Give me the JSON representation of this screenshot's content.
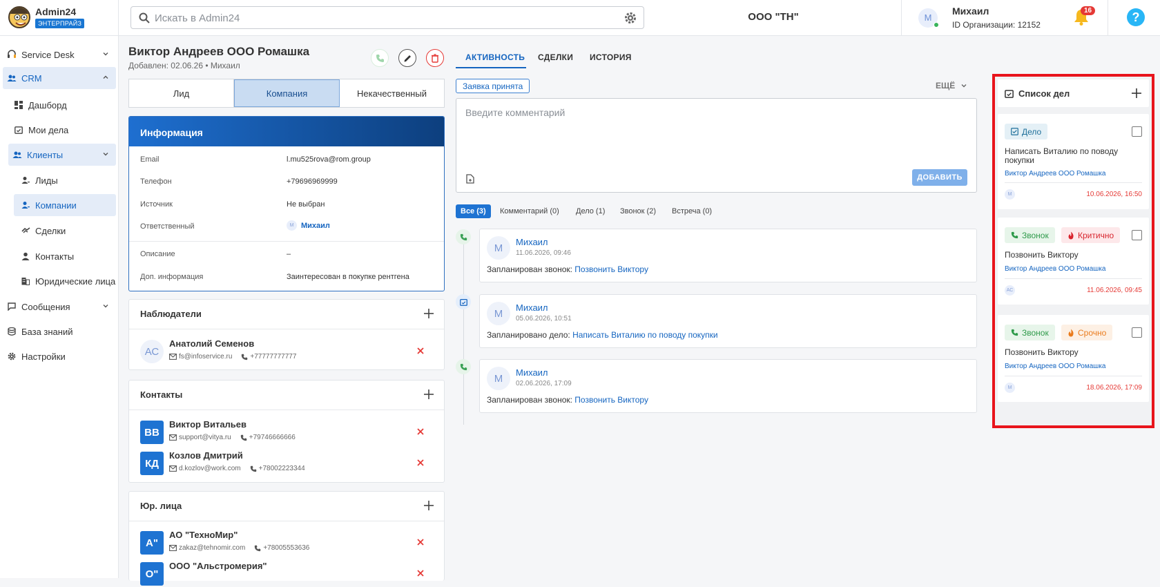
{
  "header": {
    "app_name": "Admin24",
    "edition_badge": "ЭНТЕРПРАЙЗ",
    "search_placeholder": "Искать в Admin24",
    "organization": "ООО \"ТН\"",
    "user_initial": "М",
    "user_name": "Михаил",
    "org_id": "ID Организации: 12152",
    "notifications_count": "16",
    "help_label": "?"
  },
  "sidebar": {
    "service_desk": "Service Desk",
    "crm": "CRM",
    "dashboard": "Дашборд",
    "my_tasks": "Мои дела",
    "clients": "Клиенты",
    "leads": "Лиды",
    "companies": "Компании",
    "deals": "Сделки",
    "contacts": "Контакты",
    "legal_entities": "Юридические лица",
    "messages": "Сообщения",
    "knowledge_base": "База знаний",
    "settings": "Настройки"
  },
  "entity": {
    "title": "Виктор Андреев ООО Ромашка",
    "subtitle": "Добавлен: 02.06.26 • Михаил",
    "status_tabs": [
      "Лид",
      "Компания",
      "Некачественный"
    ],
    "active_status": "Компания"
  },
  "info": {
    "header": "Информация",
    "email_label": "Email",
    "email_value": "l.mu525rova@rom.group",
    "phone_label": "Телефон",
    "phone_value": "+79696969999",
    "source_label": "Источник",
    "source_value": "Не выбран",
    "owner_label": "Ответственный",
    "owner_initial": "М",
    "owner_value": "Михаил",
    "description_label": "Описание",
    "description_value": "–",
    "extra_label": "Доп. информация",
    "extra_value": "Заинтересован в покупке рентгена"
  },
  "observers": {
    "title": "Наблюдатели",
    "items": [
      {
        "initials": "АС",
        "name": "Анатолий Семенов",
        "email": "fs@infoservice.ru",
        "phone": "+77777777777"
      }
    ]
  },
  "contacts": {
    "title": "Контакты",
    "items": [
      {
        "initials": "ВВ",
        "name": "Виктор Витальев",
        "email": "support@vitya.ru",
        "phone": "+79746666666"
      },
      {
        "initials": "КД",
        "name": "Козлов Дмитрий",
        "email": "d.kozlov@work.com",
        "phone": "+78002223344"
      }
    ]
  },
  "legal": {
    "title": "Юр. лица",
    "items": [
      {
        "initials": "А\"",
        "name": "АО \"ТехноМир\"",
        "email": "zakaz@tehnomir.com",
        "phone": "+78005553636"
      },
      {
        "initials": "О\"",
        "name": "ООО \"Альстромерия\""
      }
    ]
  },
  "activity": {
    "tabs": [
      "АКТИВНОСТЬ",
      "СДЕЛКИ",
      "ИСТОРИЯ"
    ],
    "status_pill": "Заявка принята",
    "more_label": "ЕЩЁ",
    "comment_placeholder": "Введите комментарий",
    "add_button": "ДОБАВИТЬ",
    "filters": [
      "Все (3)",
      "Комментарий (0)",
      "Дело (1)",
      "Звонок (2)",
      "Встреча (0)"
    ],
    "events": [
      {
        "type": "call",
        "initial": "М",
        "author": "Михаил",
        "date": "11.06.2026, 09:46",
        "prefix": "Запланирован звонок:",
        "link": "Позвонить Виктору"
      },
      {
        "type": "task",
        "initial": "М",
        "author": "Михаил",
        "date": "05.06.2026, 10:51",
        "prefix": "Запланировано дело:",
        "link": "Написать Виталию по поводу покупки"
      },
      {
        "type": "call",
        "initial": "М",
        "author": "Михаил",
        "date": "02.06.2026, 17:09",
        "prefix": "Запланирован звонок:",
        "link": "Позвонить Виктору"
      }
    ]
  },
  "todo": {
    "title": "Список дел",
    "items": [
      {
        "tags": [
          "Дело"
        ],
        "text": "Написать Виталию по поводу покупки",
        "link": "Виктор Андреев ООО Ромашка",
        "avatar": "М",
        "date": "10.06.2026, 16:50"
      },
      {
        "tags": [
          "Звонок",
          "Критично"
        ],
        "text": "Позвонить Виктору",
        "link": "Виктор Андреев ООО Ромашка",
        "avatar": "АС",
        "date": "11.06.2026, 09:45"
      },
      {
        "tags": [
          "Звонок",
          "Срочно"
        ],
        "text": "Позвонить Виктору",
        "link": "Виктор Андреев ООО Ромашка",
        "avatar": "М",
        "date": "18.06.2026, 17:09"
      }
    ]
  },
  "colors": {
    "accent": "#1565c0",
    "primary": "#1e73d2",
    "danger": "#e53935",
    "success": "#38b35b",
    "highlight_border": "#e8141c"
  }
}
